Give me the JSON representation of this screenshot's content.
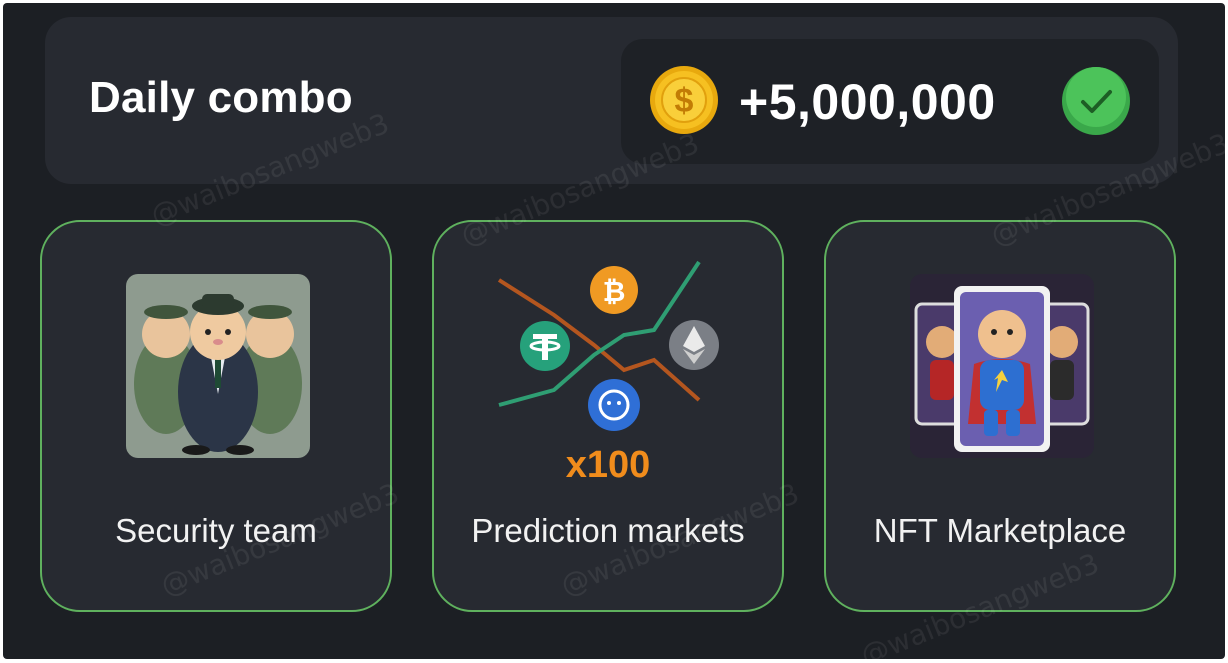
{
  "header": {
    "title": "Daily combo",
    "reward_amount": "+5,000,000",
    "coin_icon": "dollar-coin-icon",
    "status_icon": "checkmark-icon",
    "status_color": "#3aa84a"
  },
  "cards": [
    {
      "label": "Security team",
      "image": "hamster-security-team-image"
    },
    {
      "label": "Prediction markets",
      "image": "crypto-prediction-chart-image",
      "multiplier": "x100"
    },
    {
      "label": "NFT Marketplace",
      "image": "hamster-nft-cards-image"
    }
  ],
  "watermark": "@waibosangweb3",
  "colors": {
    "background": "#1c1f24",
    "panel": "#272a31",
    "card_border": "#5fb15e",
    "coin": "#f6c021",
    "multiplier": "#f08c1c"
  }
}
